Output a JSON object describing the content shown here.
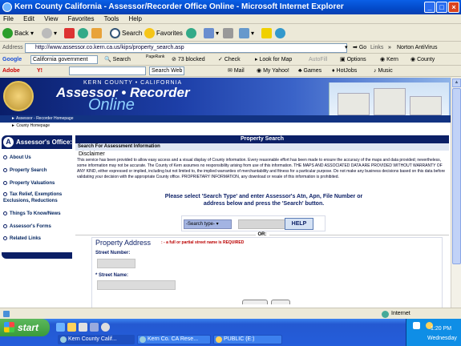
{
  "window": {
    "title": "Kern County California - Assessor/Recorder Office Online - Microsoft Internet Explorer"
  },
  "menu": [
    "File",
    "Edit",
    "View",
    "Favorites",
    "Tools",
    "Help"
  ],
  "toolbar": {
    "back": "Back",
    "search": "Search",
    "favorites": "Favorites"
  },
  "address": {
    "label": "Address",
    "url": "http://www.assessor.co.kern.ca.us/kips/property_search.asp",
    "go": "Go",
    "links": "Links",
    "norton": "Norton AntiVirus"
  },
  "google_bar": {
    "brand": "Google",
    "dropdown": "California government",
    "search": "Search",
    "pagerank": "PageRank",
    "blocked": "73 blocked",
    "check": "Check",
    "look_for_map": "Look for Map",
    "autofill": "AutoFill",
    "options": "Options",
    "kern": "Kern",
    "county": "County"
  },
  "yahoo_bar": {
    "adobe": "Adobe",
    "yahoo": "Y!",
    "search_web": "Search Web",
    "mail": "Mail",
    "my_yahoo": "My Yahoo!",
    "games": "Games",
    "hotjobs": "HotJobs",
    "music": "Music"
  },
  "banner": {
    "line1": "KERN COUNTY • CALIFORNIA",
    "line2": "Assessor • Recorder",
    "line3": "Online"
  },
  "breadcrumb": {
    "path": "► Assessor - Recorder Homepage",
    "sub": "► County Homepage"
  },
  "sidebar": {
    "header": "Assessor's Office:",
    "items": [
      {
        "label": "About Us"
      },
      {
        "label": "Property Search"
      },
      {
        "label": "Property Valuations"
      },
      {
        "label": "Tax Relief, Exemptions Exclusions, Reductions"
      },
      {
        "label": "Things To Know/News"
      },
      {
        "label": "Assessor's Forms"
      },
      {
        "label": "Related Links"
      }
    ]
  },
  "main": {
    "title": "Property Search",
    "subtitle": "Search For Assessment Information",
    "disclaimer_heading": "Disclaimer",
    "disclaimer_text": "This service has been provided to allow easy access and a visual display of County information. Every reasonable effort has been made to ensure the accuracy of the maps and data provided; nevertheless, some information may not be accurate. The County of Kern assumes no responsibility arising from use of this information. THE MAPS AND ASSOCIATED DATA ARE PROVIDED WITHOUT WARRANTY OF ANY KIND, either expressed or implied, including but not limited to, the implied warranties of merchantability and fitness for a particular purpose. Do not make any business decisions based on this data before validating your decision with the appropriate County office. PROPRIETARY INFORMATION, any download or resale of this information is prohibited.",
    "instructions": "Please select 'Search Type' and enter Assessor's Atn, Apn, File Number or address below and press the 'Search' button.",
    "search_type": "-Search type-",
    "search_value": "",
    "help": "HELP",
    "or": "OR:",
    "property_address": "Property Address",
    "required_note": ": - a full or partial street name is REQUIRED",
    "street_number_label": "Street Number:",
    "street_number_value": "",
    "street_name_label": "* Street Name:",
    "street_name_value": ""
  },
  "status": {
    "zone": "Internet"
  },
  "taskbar": {
    "start": "start",
    "tasks": [
      "Kern County Calif...",
      "Kern Co. CA Rese...",
      "PUBLIC (E:)"
    ],
    "time": "1:20 PM",
    "day": "Wednesday"
  }
}
